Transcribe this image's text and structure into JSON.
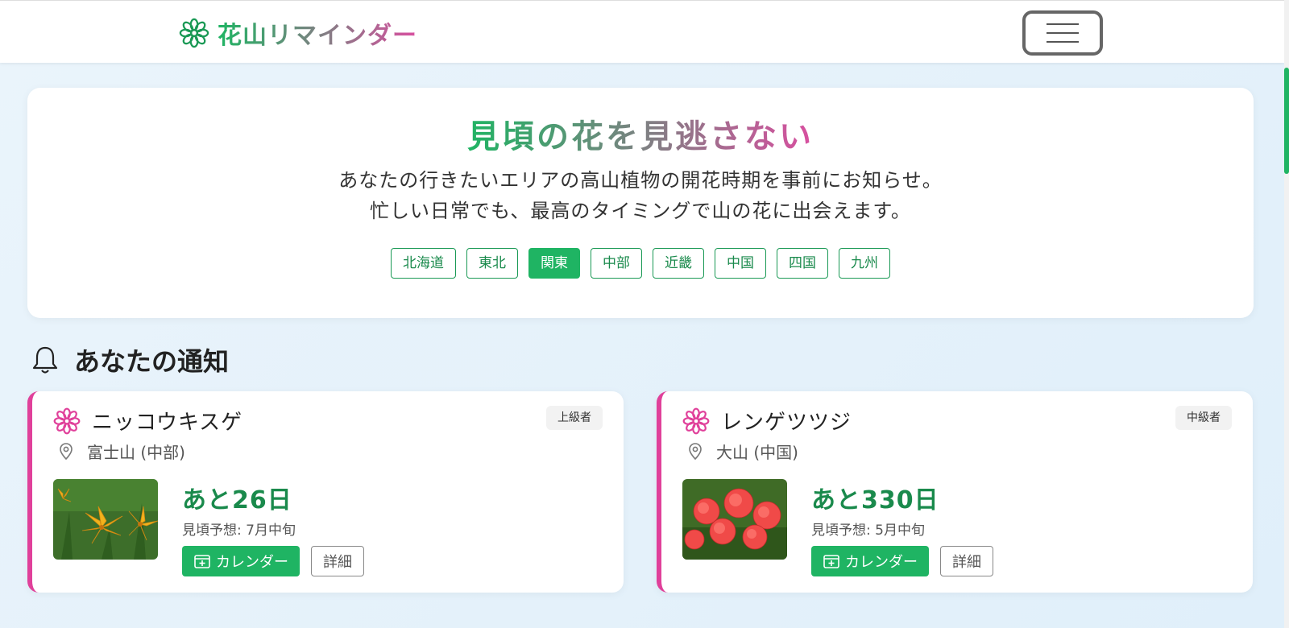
{
  "nav": {
    "brand": "花山リマインダー",
    "brand_icon": "flower-icon",
    "menu_icon": "hamburger-icon"
  },
  "hero": {
    "title": "見頃の花を見逃さない",
    "desc_line1": "あなたの行きたいエリアの高山植物の開花時期を事前にお知らせ。",
    "desc_line2": "忙しい日常でも、最高のタイミングで山の花に出会えます。",
    "regions": [
      {
        "label": "北海道",
        "active": false
      },
      {
        "label": "東北",
        "active": false
      },
      {
        "label": "関東",
        "active": true
      },
      {
        "label": "中部",
        "active": false
      },
      {
        "label": "近畿",
        "active": false
      },
      {
        "label": "中国",
        "active": false
      },
      {
        "label": "四国",
        "active": false
      },
      {
        "label": "九州",
        "active": false
      }
    ]
  },
  "notifications": {
    "title": "あなたの通知",
    "cards": [
      {
        "name": "ニッコウキスゲ",
        "level": "上級者",
        "location": "富士山 (中部)",
        "days": "あと26日",
        "forecast": "見頃予想: 7月中旬",
        "calendar": "カレンダー",
        "detail": "詳細",
        "flower_color": "#f2b21c"
      },
      {
        "name": "レンゲツツジ",
        "level": "中級者",
        "location": "大山 (中国)",
        "days": "あと330日",
        "forecast": "見頃予想: 5月中旬",
        "calendar": "カレンダー",
        "detail": "詳細",
        "flower_color": "#f04a48"
      }
    ]
  },
  "colors": {
    "accent": "#1fb463",
    "pink": "#e0409a",
    "green_text": "#1a8a4c"
  }
}
